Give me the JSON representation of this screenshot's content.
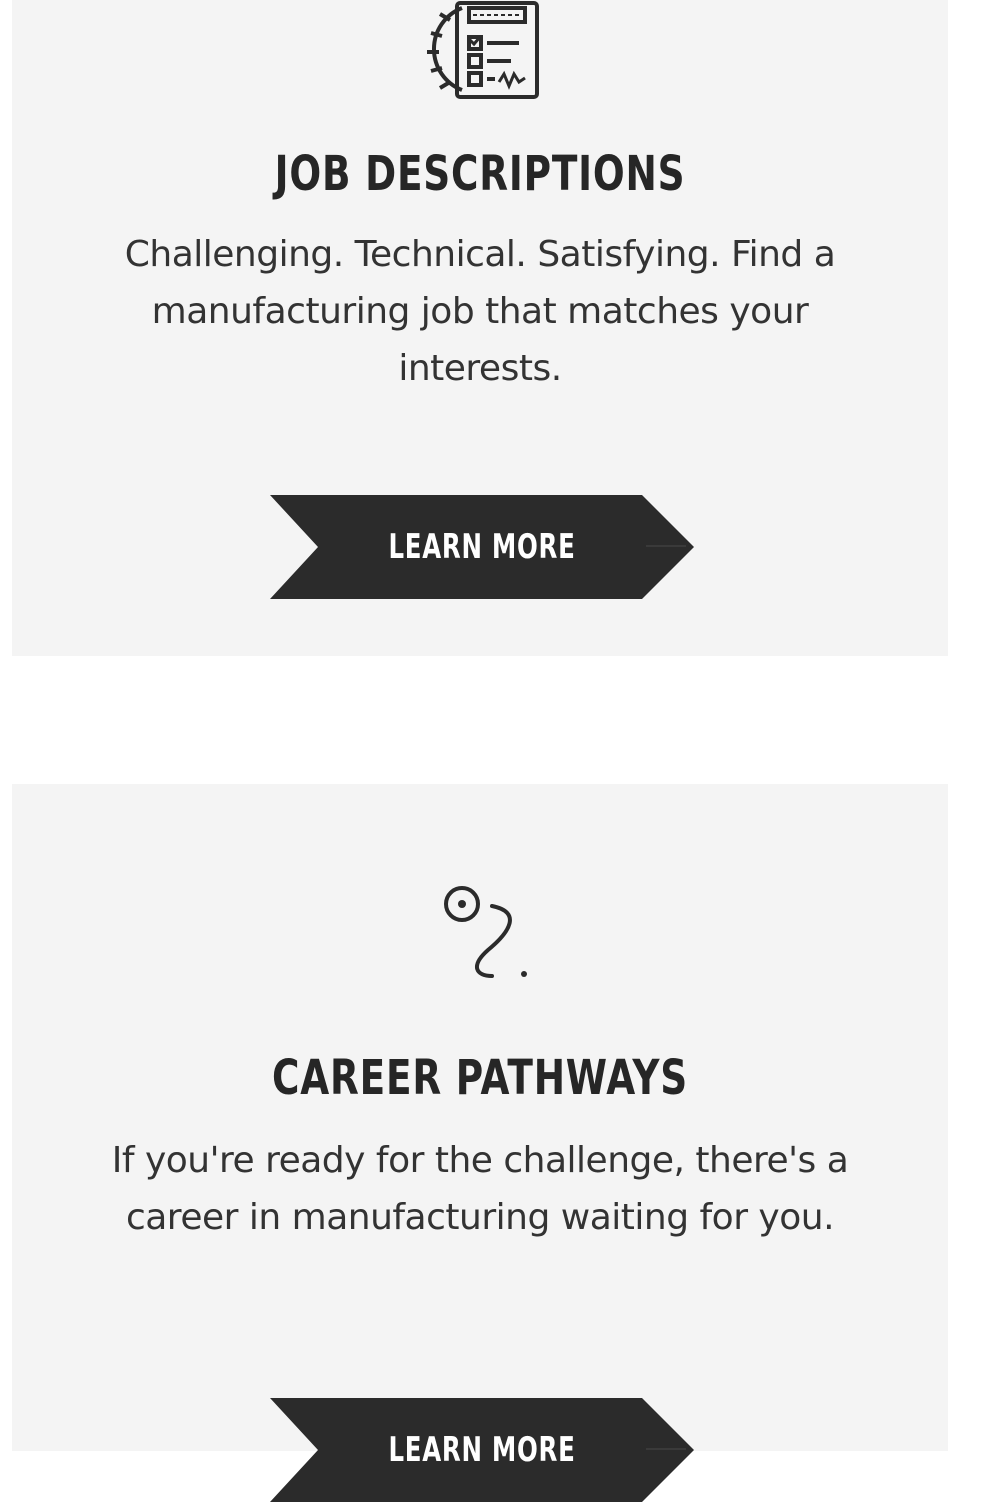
{
  "cards": [
    {
      "icon": "checklist-gear-icon",
      "title": "JOB DESCRIPTIONS",
      "description": "Challenging. Technical. Satisfying. Find a manufacturing job that matches your interests.",
      "button_label": "LEARN MORE"
    },
    {
      "icon": "pathway-icon",
      "title": "CAREER PATHWAYS",
      "description": "If you're ready for the challenge, there's a career in manufacturing waiting for you.",
      "button_label": "LEARN MORE"
    }
  ],
  "colors": {
    "card_background": "#f4f4f4",
    "page_background": "#ffffff",
    "button_background": "#2b2b2b",
    "button_text": "#ffffff",
    "heading_text": "#262626",
    "body_text": "#333333"
  }
}
